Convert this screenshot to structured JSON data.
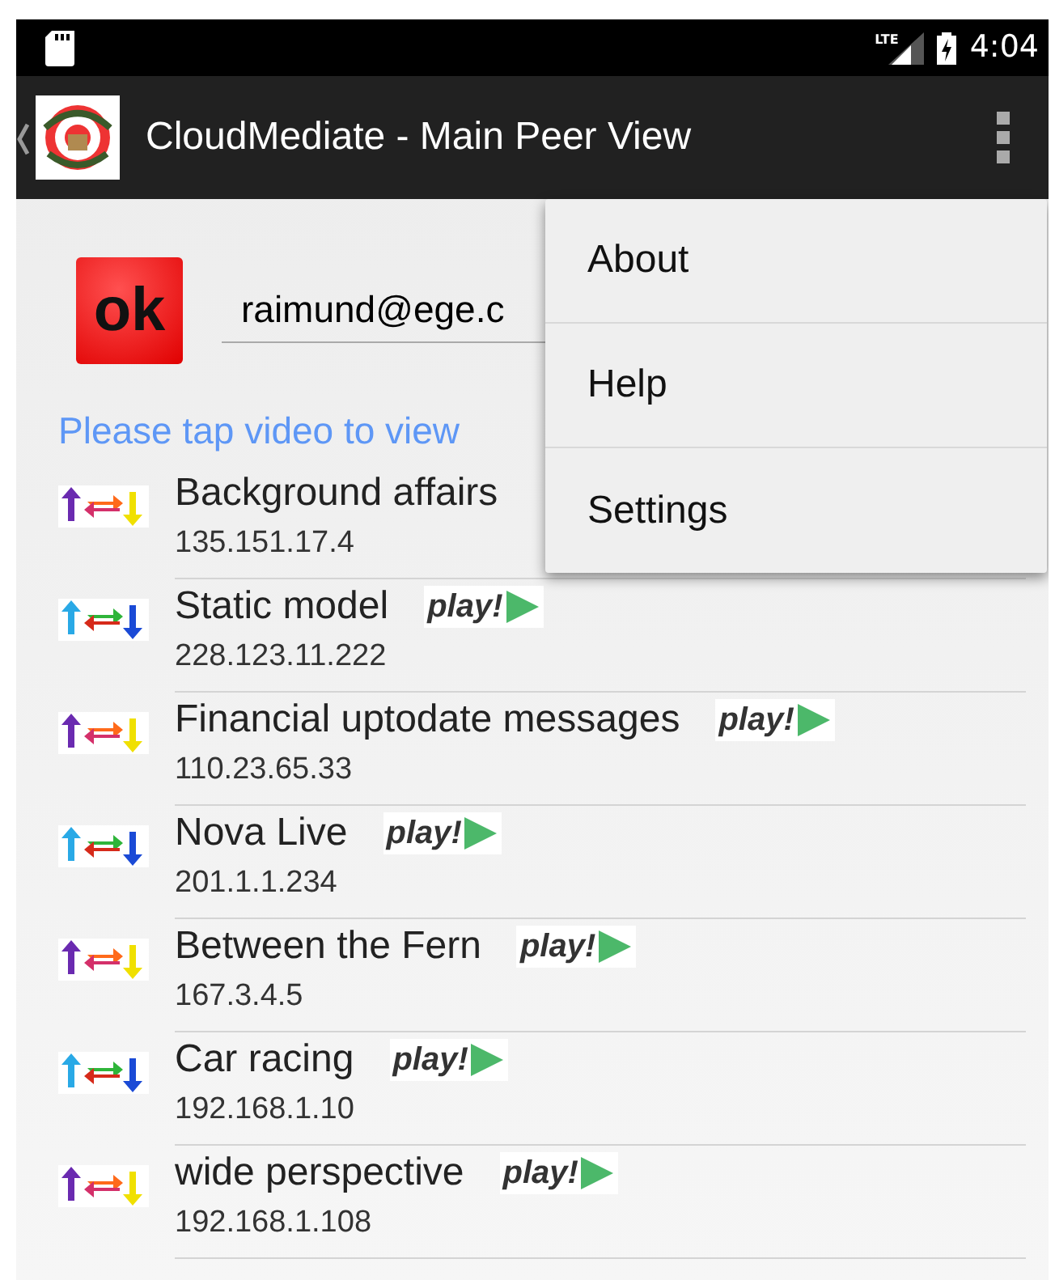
{
  "status_bar": {
    "time": "4:04",
    "network": "LTE"
  },
  "action_bar": {
    "title": "CloudMediate - Main Peer View"
  },
  "login": {
    "status": "ok",
    "email": "raimund@ege.c"
  },
  "hint": "Please tap video to view",
  "peers": [
    {
      "kind": "warm",
      "name": "Background affairs",
      "ip": "135.151.17.4"
    },
    {
      "kind": "cool",
      "name": "Static model",
      "ip": "228.123.11.222",
      "play_label": "play!"
    },
    {
      "kind": "warm",
      "name": "Financial uptodate messages",
      "ip": "110.23.65.33",
      "play_label": "play!"
    },
    {
      "kind": "cool",
      "name": "Nova Live",
      "ip": "201.1.1.234",
      "play_label": "play!"
    },
    {
      "kind": "warm",
      "name": "Between the Fern",
      "ip": "167.3.4.5",
      "play_label": "play!"
    },
    {
      "kind": "cool",
      "name": "Car racing",
      "ip": "192.168.1.10",
      "play_label": "play!"
    },
    {
      "kind": "warm",
      "name": "wide perspective",
      "ip": "192.168.1.108",
      "play_label": "play!"
    }
  ],
  "menu": {
    "items": [
      "About",
      "Help",
      "Settings"
    ]
  }
}
